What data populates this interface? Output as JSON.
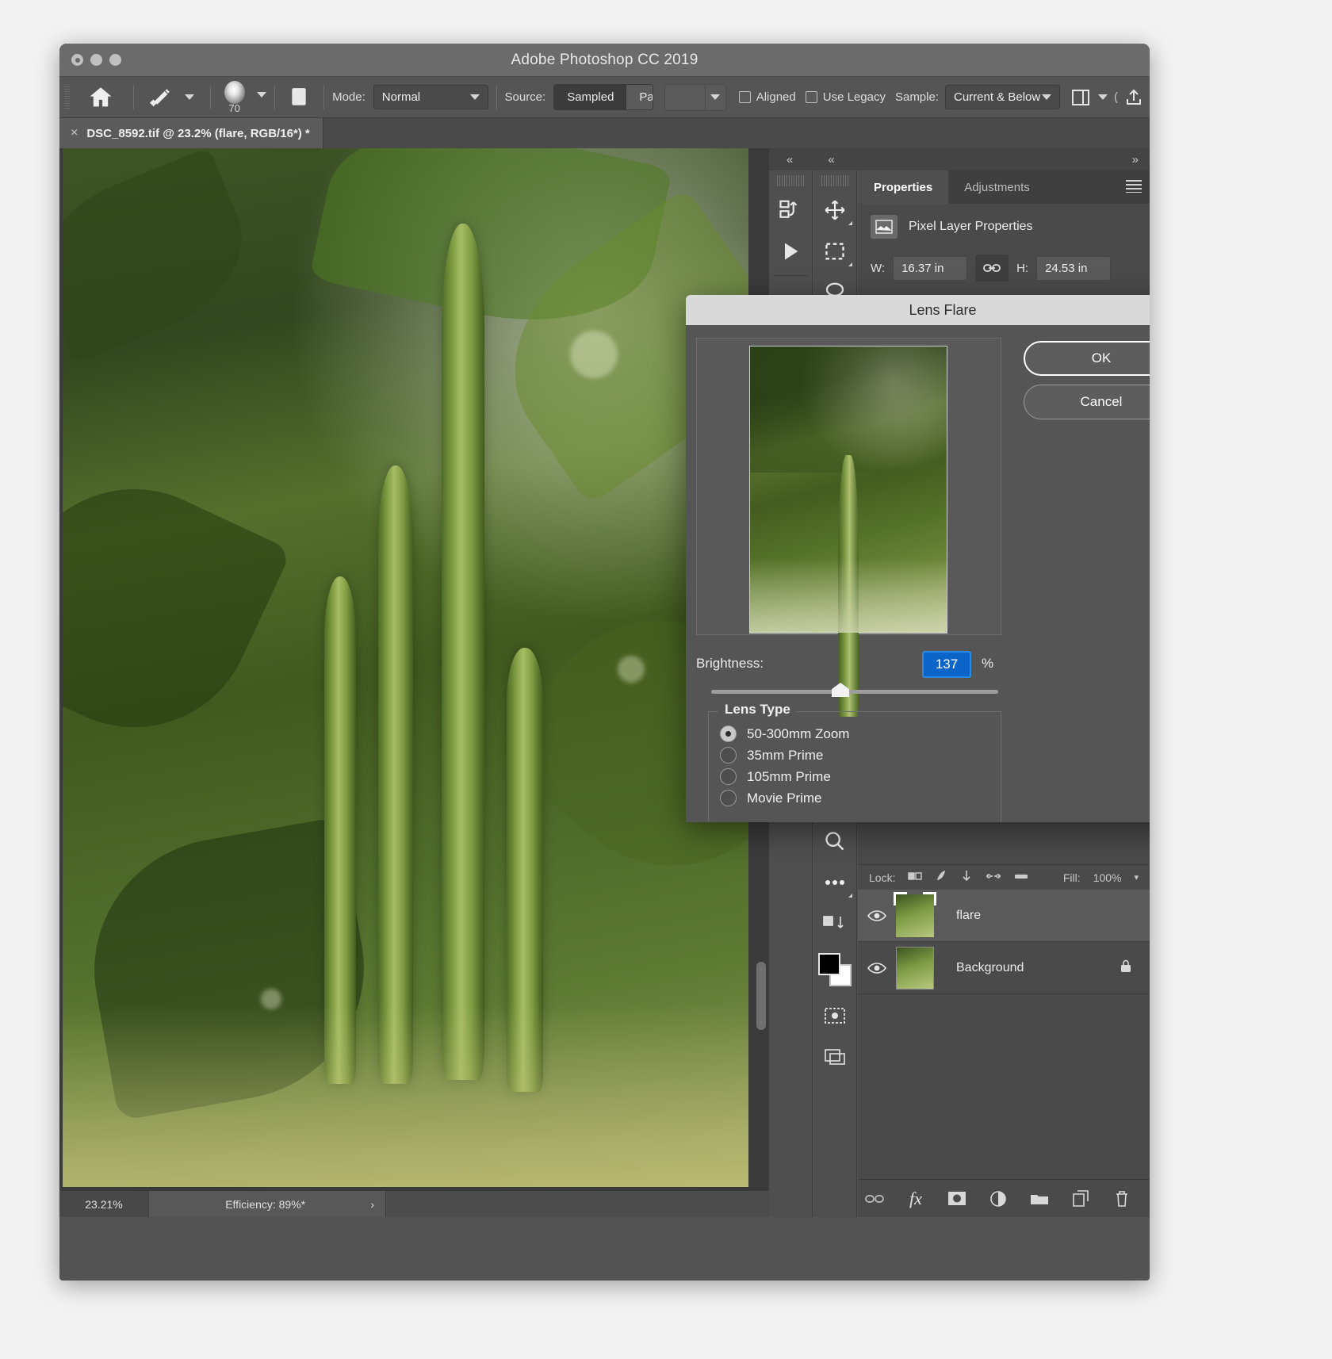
{
  "window": {
    "title": "Adobe Photoshop CC 2019",
    "traffic": [
      "close",
      "minimize",
      "zoom"
    ]
  },
  "options_bar": {
    "home_icon": "home-icon",
    "tool_icon": "healing-brush-icon",
    "brush_size": "70",
    "clone_stamp_icon": "clone-stamp-icon",
    "mode_label": "Mode:",
    "mode_value": "Normal",
    "source_label": "Source:",
    "source_options": [
      "Sampled",
      "Pattern"
    ],
    "source_selected": "Sampled",
    "aligned_label": "Aligned",
    "aligned_checked": false,
    "use_legacy_label": "Use Legacy",
    "use_legacy_checked": false,
    "sample_label": "Sample:",
    "sample_value": "Current & Below",
    "share_icon": "share-icon",
    "workspace_icon": "workspace-icon"
  },
  "document_tab": {
    "close_icon": "×",
    "title": "DSC_8592.tif @ 23.2% (flare, RGB/16*) *"
  },
  "status_bar": {
    "zoom": "23.21%",
    "efficiency": "Efficiency: 89%*",
    "arrow": "›"
  },
  "tools": {
    "left_column": [
      "artboard-icon",
      "play-icon"
    ],
    "right_column": [
      "move-icon",
      "marquee-icon",
      "lasso-icon",
      "zoom-icon",
      "more-tools-icon",
      "swap-colors-icon",
      "color-swatches",
      "quick-mask-icon",
      "screen-mode-icon"
    ],
    "collapse_icon": "«"
  },
  "properties_panel": {
    "tabs": [
      {
        "label": "Properties",
        "active": true
      },
      {
        "label": "Adjustments",
        "active": false
      }
    ],
    "menu_icon": "panel-menu-icon",
    "header_icon": "pixel-layer-icon",
    "header_label": "Pixel Layer Properties",
    "width_label": "W:",
    "width_value": "16.37 in",
    "link_icon": "link-icon",
    "height_label": "H:",
    "height_value": "24.53 in",
    "expand_icon": "»"
  },
  "layers_panel": {
    "lock_label": "Lock:",
    "lock_icons": [
      "lock-transparent-pixels",
      "lock-image-pixels",
      "lock-position",
      "lock-artboard-nesting",
      "lock-all"
    ],
    "fill_label": "Fill:",
    "fill_value": "100%",
    "layers": [
      {
        "name": "flare",
        "visible": true,
        "selected": true,
        "locked": false
      },
      {
        "name": "Background",
        "visible": true,
        "selected": false,
        "locked": true
      }
    ],
    "bottom_icons": [
      "link-layers-icon",
      "fx-icon",
      "add-mask-icon",
      "adjustment-layer-icon",
      "new-group-icon",
      "new-layer-icon",
      "delete-layer-icon"
    ]
  },
  "dialog": {
    "title": "Lens Flare",
    "ok_label": "OK",
    "cancel_label": "Cancel",
    "brightness_label": "Brightness:",
    "brightness_value": "137",
    "brightness_unit": "%",
    "lens_type_title": "Lens Type",
    "lens_types": [
      {
        "label": "50-300mm Zoom",
        "selected": true
      },
      {
        "label": "35mm Prime",
        "selected": false
      },
      {
        "label": "105mm Prime",
        "selected": false
      },
      {
        "label": "Movie Prime",
        "selected": false
      }
    ]
  },
  "colors": {
    "accent_blue": "#0b64c8",
    "window_chrome": "#6b6b6b",
    "panel_bg": "#4a4a4a",
    "canvas_bg": "#3b3b3b",
    "dialog_bg": "#555555",
    "dialog_title_bg": "#d9d9d9"
  }
}
